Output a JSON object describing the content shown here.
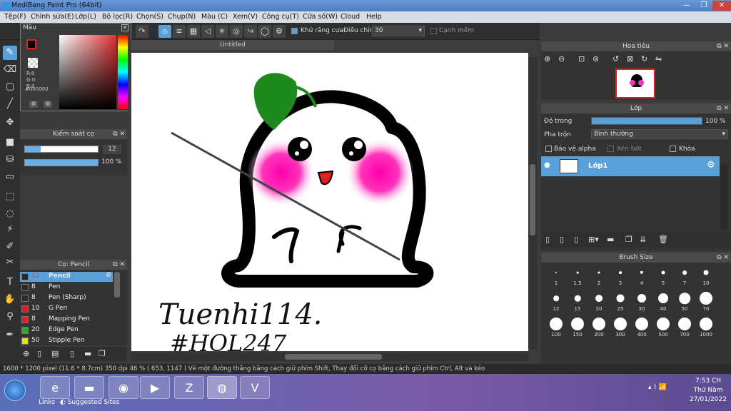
{
  "window": {
    "title": "MediBang Paint Pro (64bit)"
  },
  "menu": [
    "Tệp(F)",
    "Chỉnh sửa(E)",
    "Lớp(L)",
    "Bộ lọc(R)",
    "Chọn(S)",
    "Chụp(N)",
    "Màu (C)",
    "Xem(V)",
    "Công cụ(T)",
    "Cửa số(W)",
    "Cloud",
    "Help"
  ],
  "toolbar": {
    "antialias_label": "Khử răng cưa",
    "adjust_label": "Điều chỉnh",
    "adjust_value": "30",
    "snap_label": "Cạnh mềm"
  },
  "color_panel": {
    "title": "Màu",
    "r": "R:0",
    "g": "G:0",
    "b": "B:0",
    "hex": "#000000"
  },
  "brush_control": {
    "title": "Kiểm soát cọ",
    "size": "12",
    "opacity": "100 %"
  },
  "brush_list": {
    "title": "Cọ: Pencil",
    "items": [
      {
        "size": "12",
        "name": "Pencil",
        "color": "#2a2a2a"
      },
      {
        "size": "8",
        "name": "Pen",
        "color": "#2a2a2a"
      },
      {
        "size": "8",
        "name": "Pen (Sharp)",
        "color": "#2a2a2a"
      },
      {
        "size": "10",
        "name": "G Pen",
        "color": "#e02020"
      },
      {
        "size": "8",
        "name": "Mapping Pen",
        "color": "#e02020"
      },
      {
        "size": "20",
        "name": "Edge Pen",
        "color": "#20b020"
      },
      {
        "size": "50",
        "name": "Stipple Pen",
        "color": "#e0e020"
      }
    ]
  },
  "canvas": {
    "tab": "Untitled",
    "sign_line1": "Tuenhi114.",
    "sign_line2": "#HOL247"
  },
  "navigator": {
    "title": "Hoa tiêu"
  },
  "layer_panel": {
    "title": "Lớp",
    "opacity_label": "Độ trong",
    "opacity_value": "100 %",
    "opacity_fraction": 1.0,
    "blend_label": "Pha trộn",
    "blend_value": "Bình thường",
    "protect_alpha": "Bảo vệ alpha",
    "clipping": "Xén bớt",
    "lock": "Khóa",
    "layer_name": "Lớp1"
  },
  "brush_size": {
    "title": "Brush Size",
    "sizes": [
      "1",
      "1.5",
      "2",
      "3",
      "4",
      "5",
      "7",
      "10",
      "12",
      "15",
      "20",
      "25",
      "30",
      "40",
      "50",
      "70",
      "100",
      "150",
      "200",
      "300",
      "400",
      "500",
      "700",
      "1000"
    ]
  },
  "status": {
    "text": "1600 * 1200 pixel   (11.6 * 8.7cm)   350 dpi   46 %   ( 653, 1147 )   Vẽ một đường thẳng bằng cách giữ phím Shift, Thay đổi cỡ cọ bằng cách giữ phím Ctrl, Alt và kéo"
  },
  "taskbar": {
    "links": "Links",
    "suggested": "Suggested Sites",
    "time": "7:53 CH",
    "day": "Thứ Năm",
    "date": "27/01/2022"
  }
}
